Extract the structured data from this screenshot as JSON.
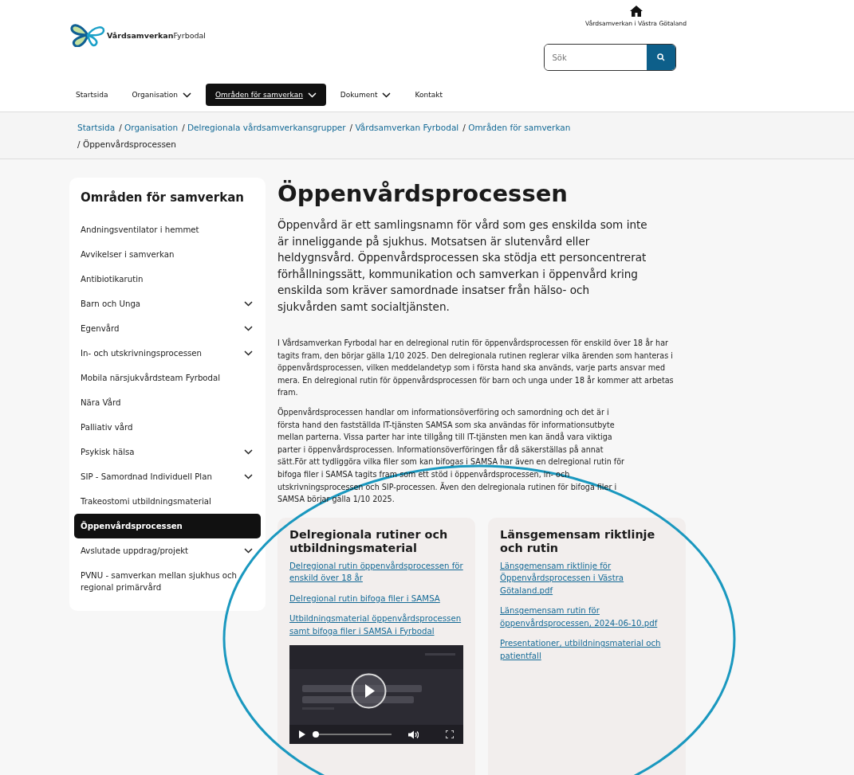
{
  "header": {
    "logo_text": "**Vårdsamverkan**Fyrbodal",
    "home_link": "Vårdsamverkan i Västra Götaland",
    "search": {
      "placeholder": "Sök"
    }
  },
  "nav": [
    {
      "label": "Startsida",
      "selected": false,
      "has_menu": false
    },
    {
      "label": "Organisation",
      "selected": false,
      "has_menu": true
    },
    {
      "label": "Områden för samverkan",
      "selected": true,
      "has_menu": true
    },
    {
      "label": "Dokument",
      "selected": false,
      "has_menu": true
    },
    {
      "label": "Kontakt",
      "selected": false,
      "has_menu": false
    }
  ],
  "breadcrumbs": {
    "separator": "/",
    "items": [
      {
        "label": "Startsida",
        "kind": "link"
      },
      {
        "label": "Organisation",
        "kind": "link"
      },
      {
        "label": "Delregionala vårdsamverkansgrupper",
        "kind": "link"
      },
      {
        "label": "Vårdsamverkan Fyrbodal",
        "kind": "link"
      },
      {
        "label": "Områden för samverkan",
        "kind": "link"
      },
      {
        "label": "Öppenvårdsprocessen",
        "kind": "current"
      }
    ]
  },
  "sidebar": {
    "title": "Områden för samverkan",
    "items": [
      {
        "label": "Andningsventilator i hemmet",
        "selected": false,
        "expandable": false
      },
      {
        "label": "Avvikelser i samverkan",
        "selected": false,
        "expandable": false
      },
      {
        "label": "Antibiotikarutin",
        "selected": false,
        "expandable": false
      },
      {
        "label": "Barn och Unga",
        "selected": false,
        "expandable": true
      },
      {
        "label": "Egenvård",
        "selected": false,
        "expandable": true
      },
      {
        "label": "In- och utskrivningsprocessen",
        "selected": false,
        "expandable": true
      },
      {
        "label": "Mobila närsjukvårdsteam Fyrbodal",
        "selected": false,
        "expandable": false
      },
      {
        "label": "Nära Vård",
        "selected": false,
        "expandable": false
      },
      {
        "label": "Palliativ vård",
        "selected": false,
        "expandable": false
      },
      {
        "label": "Psykisk hälsa",
        "selected": false,
        "expandable": true
      },
      {
        "label": "SIP - Samordnad Individuell Plan",
        "selected": false,
        "expandable": true
      },
      {
        "label": "Trakeostomi utbildningsmaterial",
        "selected": false,
        "expandable": false
      },
      {
        "label": "Öppenvårdsprocessen",
        "selected": true,
        "expandable": false
      },
      {
        "label": "Avslutade uppdrag/projekt",
        "selected": false,
        "expandable": true
      },
      {
        "label": "PVNU - samverkan mellan sjukhus och regional primärvård",
        "selected": false,
        "expandable": false
      }
    ]
  },
  "article": {
    "title": "Öppenvårdsprocessen",
    "lead": "Öppenvård är ett samlingsnamn för vård som ges enskilda som inte är inneliggande på sjukhus. Motsatsen är slutenvård eller heldygnsvård. Öppenvårdsprocessen ska stödja ett personcentrerat förhållningssätt, kommunikation och samverkan i öppenvård kring enskilda som kräver samordnade insatser från hälso- och sjukvården samt socialtjänsten.",
    "paragraphs": [
      "I Vårdsamverkan Fyrbodal har en delregional rutin för öppenvårdsprocessen för enskild över 18 år har tagits fram, den börjar gälla 1/10 2025. Den delregionala rutinen reglerar vilka ärenden som hanteras i öppenvårdsprocessen, vilken meddelandetyp som i första hand ska används, varje parts ansvar med mera. En delregional rutin för öppenvårdsprocessen för barn och unga under 18 år kommer att arbetas fram.",
      "Öppenvårdsprocessen handlar om informationsöverföring och samordning och det är i första hand den fastställda IT-tjänsten SAMSA som ska användas för informationsutbyte mellan parterna. Vissa parter har inte tillgång till IT-tjänsten men kan ändå vara viktiga parter i öppenvårdsprocessen. Informationsöverföringen får då säkerställas på annat sätt.För att tydliggöra vilka filer som kan bifogas i SAMSA har även en delregional rutin för bifoga filer i SAMSA tagits fram som ett stöd i öppenvårdsprocessen, in- och utskrivningsprocessen och SIP-processen. Även den delregionala rutinen för bifoga filer i SAMSA börjar gälla 1/10 2025."
    ]
  },
  "cards": [
    {
      "title": "Delregionala rutiner och utbildningsmaterial",
      "links": [
        "Delregional rutin öppenvårdsprocessen för enskild över 18 år",
        "Delregional rutin bifoga filer i SAMSA",
        "Utbildningsmaterial öppenvårdsprocessen samt bifoga filer i SAMSA i Fyrbodal"
      ],
      "video": {
        "kind": "picture",
        "level": 0.03
      }
    },
    {
      "title": "Länsgemensam riktlinje och rutin",
      "links": [
        "Länsgemensam riktlinje för Öppenvårdsprocessen i Västra Götaland.pdf",
        "Länsgemensam rutin för öppenvårdsprocessen, 2024-06-10.pdf",
        "Presentationer, utbildningsmaterial och patientfall"
      ]
    }
  ],
  "annotation": {
    "kind": "ellipse"
  }
}
